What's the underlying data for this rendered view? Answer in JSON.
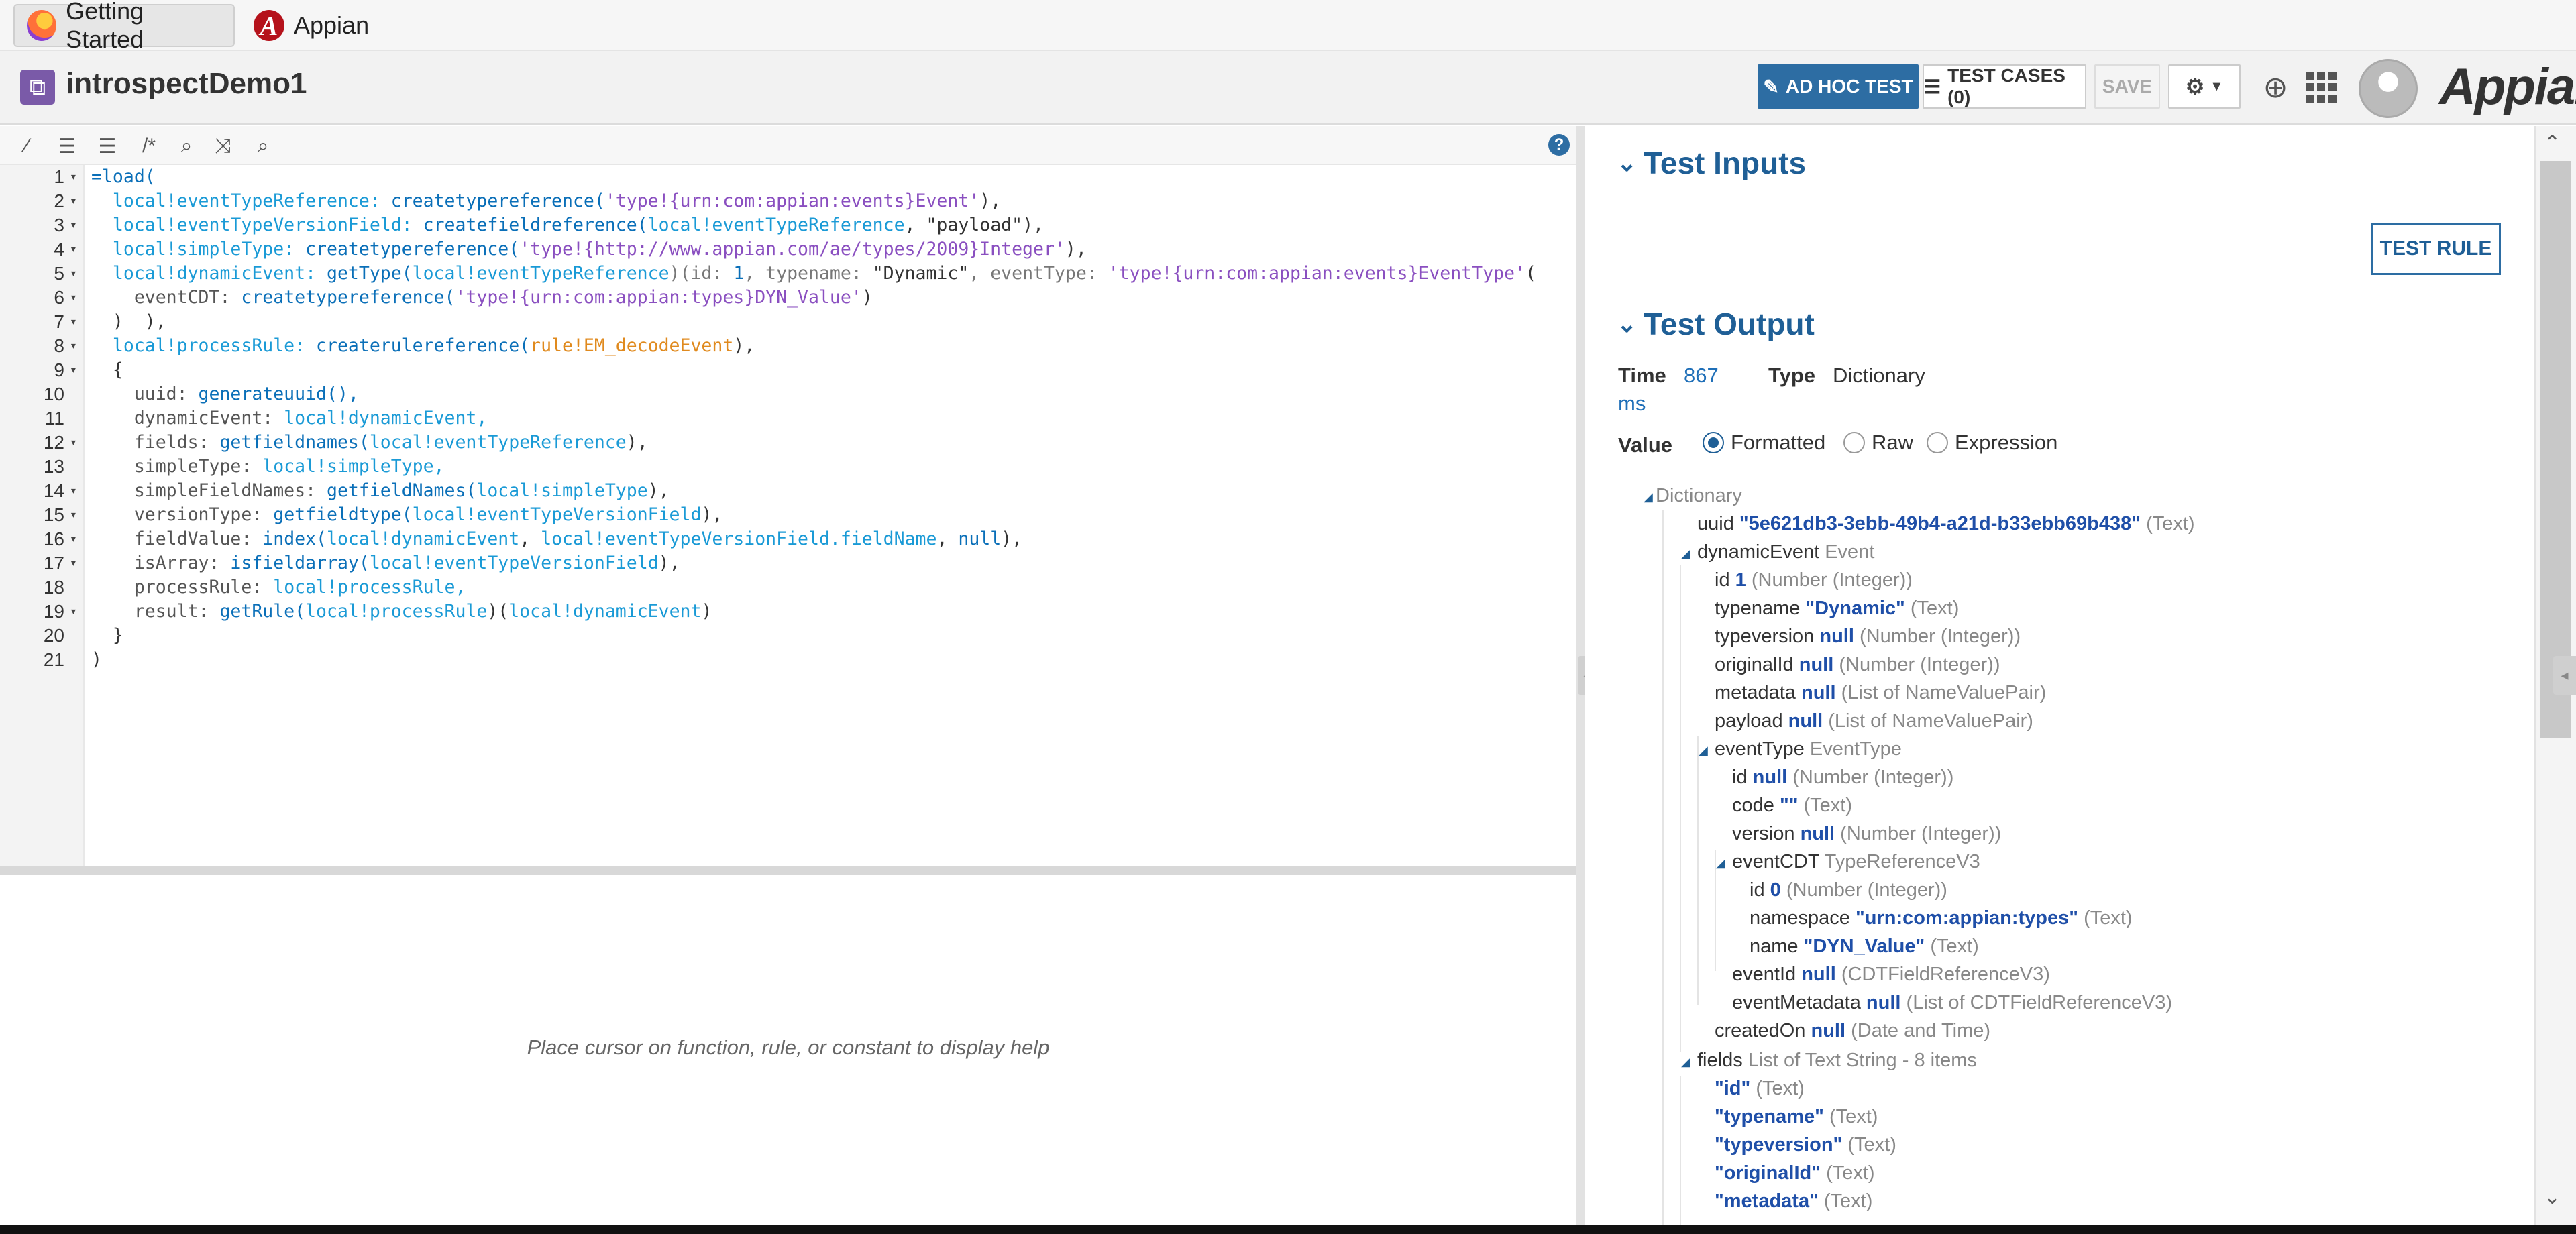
{
  "browser": {
    "tabs": [
      {
        "label": "Getting Started",
        "icon": "firefox-icon"
      },
      {
        "label": "Appian",
        "icon": "appian-favicon-icon"
      }
    ]
  },
  "header": {
    "rule_name": "introspectDemo1",
    "adhoc_label": "AD HOC TEST",
    "testcases_label": "TEST CASES (0)",
    "save_label": "SAVE",
    "logo": "Appian"
  },
  "editor": {
    "lines": [
      {
        "n": "1",
        "fold": true
      },
      {
        "n": "2",
        "fold": true
      },
      {
        "n": "3",
        "fold": true
      },
      {
        "n": "4",
        "fold": true
      },
      {
        "n": "5",
        "fold": true
      },
      {
        "n": "6",
        "fold": true
      },
      {
        "n": "7",
        "fold": true
      },
      {
        "n": "8",
        "fold": true
      },
      {
        "n": "9",
        "fold": true
      },
      {
        "n": "10",
        "fold": false
      },
      {
        "n": "11",
        "fold": false
      },
      {
        "n": "12",
        "fold": true
      },
      {
        "n": "13",
        "fold": false
      },
      {
        "n": "14",
        "fold": true
      },
      {
        "n": "15",
        "fold": true
      },
      {
        "n": "16",
        "fold": true
      },
      {
        "n": "17",
        "fold": true
      },
      {
        "n": "18",
        "fold": false
      },
      {
        "n": "19",
        "fold": true
      },
      {
        "n": "20",
        "fold": false
      },
      {
        "n": "21",
        "fold": false
      }
    ],
    "code": {
      "l1": "=load(",
      "l2a": "  local!eventTypeReference: ",
      "l2b": "createtypereference(",
      "l2c": "'type!{urn:com:appian:events}Event'",
      "l2d": "),",
      "l3a": "  local!eventTypeVersionField: ",
      "l3b": "createfieldreference(",
      "l3c": "local!eventTypeReference",
      "l3d": ", ",
      "l3e": "\"payload\"",
      "l3f": "),",
      "l4a": "  local!simpleType: ",
      "l4b": "createtypereference(",
      "l4c": "'type!{http://www.appian.com/ae/types/2009}Integer'",
      "l4d": "),",
      "l5a": "  local!dynamicEvent: ",
      "l5b": "getType(",
      "l5c": "local!eventTypeReference",
      "l5d": ")(id: ",
      "l5e": "1",
      "l5f": ", typename: ",
      "l5g": "\"Dynamic\"",
      "l5h": ", eventType: ",
      "l5i": "'type!{urn:com:appian:events}EventType'",
      "l5j": "(",
      "l6a": "    eventCDT: ",
      "l6b": "createtypereference(",
      "l6c": "'type!{urn:com:appian:types}DYN_Value'",
      "l6d": ")",
      "l7": "  )  ),",
      "l8a": "  local!processRule: ",
      "l8b": "createrulereference(",
      "l8c": "rule!EM_decodeEvent",
      "l8d": "),",
      "l9": "  {",
      "l10a": "    uuid: ",
      "l10b": "generateuuid(),",
      "l11a": "    dynamicEvent: ",
      "l11b": "local!dynamicEvent,",
      "l12a": "    fields: ",
      "l12b": "getfieldnames(",
      "l12c": "local!eventTypeReference",
      "l12d": "),",
      "l13a": "    simpleType: ",
      "l13b": "local!simpleType,",
      "l14a": "    simpleFieldNames: ",
      "l14b": "getfieldNames(",
      "l14c": "local!simpleType",
      "l14d": "),",
      "l15a": "    versionType: ",
      "l15b": "getfieldtype(",
      "l15c": "local!eventTypeVersionField",
      "l15d": "),",
      "l16a": "    fieldValue: ",
      "l16b": "index(",
      "l16c": "local!dynamicEvent",
      "l16d": ", ",
      "l16e": "local!eventTypeVersionField.fieldName",
      "l16f": ", ",
      "l16g": "null",
      "l16h": "),",
      "l17a": "    isArray: ",
      "l17b": "isfieldarray(",
      "l17c": "local!eventTypeVersionField",
      "l17d": "),",
      "l18a": "    processRule: ",
      "l18b": "local!processRule,",
      "l19a": "    result: ",
      "l19b": "getRule(",
      "l19c": "local!processRule",
      "l19d": ")(",
      "l19e": "local!dynamicEvent",
      "l19f": ")",
      "l20": "  }",
      "l21": ")"
    },
    "help_text": "Place cursor on function, rule, or constant to display help"
  },
  "test": {
    "inputs_title": "Test Inputs",
    "test_rule_label": "TEST RULE",
    "output_title": "Test Output",
    "time_label": "Time",
    "time_value": "867",
    "time_unit": "ms",
    "type_label": "Type",
    "type_value": "Dictionary",
    "value_label": "Value",
    "radio_formatted": "Formatted",
    "radio_raw": "Raw",
    "radio_expression": "Expression"
  },
  "tree": {
    "root": "Dictionary",
    "uuid_k": "uuid",
    "uuid_v": "\"5e621db3-3ebb-49b4-a21d-b33ebb69b438\"",
    "uuid_t": "(Text)",
    "de_k": "dynamicEvent",
    "de_t": "Event",
    "id_k": "id",
    "id_v": "1",
    "id_t": "(Number (Integer))",
    "tn_k": "typename",
    "tn_v": "\"Dynamic\"",
    "tn_t": "(Text)",
    "tv_k": "typeversion",
    "tv_v": "null",
    "tv_t": "(Number (Integer))",
    "oi_k": "originalId",
    "oi_v": "null",
    "oi_t": "(Number (Integer))",
    "md_k": "metadata",
    "md_v": "null",
    "md_t": "(List of NameValuePair)",
    "pl_k": "payload",
    "pl_v": "null",
    "pl_t": "(List of NameValuePair)",
    "et_k": "eventType",
    "et_t": "EventType",
    "et_id_k": "id",
    "et_id_v": "null",
    "et_id_t": "(Number (Integer))",
    "code_k": "code",
    "code_v": "\"\"",
    "code_t": "(Text)",
    "ver_k": "version",
    "ver_v": "null",
    "ver_t": "(Number (Integer))",
    "cdt_k": "eventCDT",
    "cdt_t": "TypeReferenceV3",
    "cdt_id_k": "id",
    "cdt_id_v": "0",
    "cdt_id_t": "(Number (Integer))",
    "ns_k": "namespace",
    "ns_v": "\"urn:com:appian:types\"",
    "ns_t": "(Text)",
    "nm_k": "name",
    "nm_v": "\"DYN_Value\"",
    "nm_t": "(Text)",
    "eid_k": "eventId",
    "eid_v": "null",
    "eid_t": "(CDTFieldReferenceV3)",
    "emd_k": "eventMetadata",
    "emd_v": "null",
    "emd_t": "(List of CDTFieldReferenceV3)",
    "co_k": "createdOn",
    "co_v": "null",
    "co_t": "(Date and Time)",
    "f_k": "fields",
    "f_t": "List of Text String - 8 items",
    "f1": "\"id\"",
    "f2": "\"typename\"",
    "f3": "\"typeversion\"",
    "f4": "\"originalId\"",
    "f5": "\"metadata\"",
    "ft": "(Text)"
  }
}
